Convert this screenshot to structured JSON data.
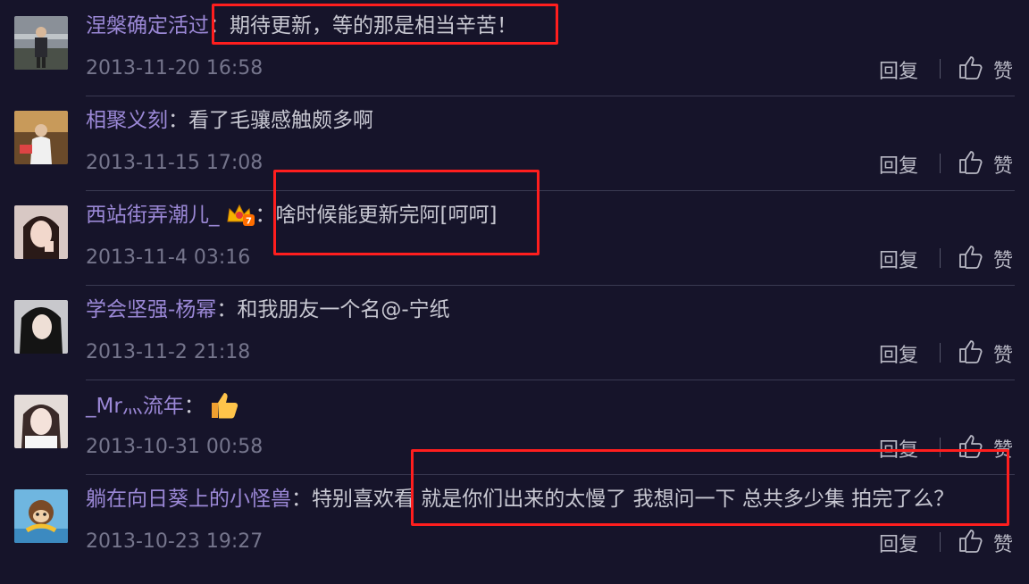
{
  "comments": [
    {
      "username": "涅槃确定活过",
      "separator": "：",
      "text": "期待更新，等的那是相当辛苦！",
      "timestamp": "2013-11-20 16:58",
      "reply": "回复",
      "like": "赞",
      "avatar": "man-standing-photo"
    },
    {
      "username": "相聚义刻",
      "separator": "：",
      "text": "看了毛骧感触颇多啊",
      "timestamp": "2013-11-15 17:08",
      "reply": "回复",
      "like": "赞",
      "avatar": "man-desk-photo"
    },
    {
      "username": "西站街弄潮儿_",
      "separator": "：",
      "text": "啥时候能更新完阿[呵呵]",
      "timestamp": "2013-11-4 03:16",
      "reply": "回复",
      "like": "赞",
      "avatar": "girl-selfie-photo",
      "badge": "crown-level-badge"
    },
    {
      "username": "学会坚强-杨幂",
      "separator": "：",
      "text": "和我朋友一个名@-宁纸",
      "timestamp": "2013-11-2 21:18",
      "reply": "回复",
      "like": "赞",
      "avatar": "woman-portrait-photo"
    },
    {
      "username": "_Mr灬流年",
      "separator": "：",
      "text": "",
      "timestamp": "2013-10-31 00:58",
      "reply": "回复",
      "like": "赞",
      "avatar": "girl-portrait-photo",
      "emoji": "thumbs-up-emoji"
    },
    {
      "username": "躺在向日葵上的小怪兽",
      "separator": "：",
      "text": "特别喜欢看 就是你们出来的太慢了 我想问一下 总共多少集 拍完了么？",
      "timestamp": "2013-10-23 19:27",
      "reply": "回复",
      "like": "赞",
      "avatar": "cartoon-avatar"
    }
  ],
  "colors": {
    "background": "#16142a",
    "username": "#9b88d6",
    "text": "#c8c8d2",
    "timestamp": "#75758c",
    "highlight": "#ff1e1e"
  }
}
